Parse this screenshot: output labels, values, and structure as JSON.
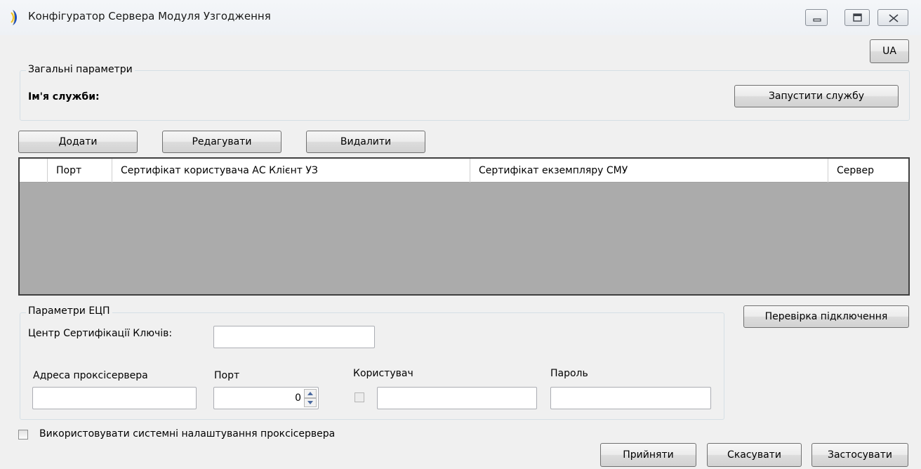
{
  "window": {
    "title": "Конфігуратор Сервера Модуля Узгодження",
    "language_button": "UA"
  },
  "general": {
    "legend": "Загальні параметри",
    "service_name_label": "Ім'я служби:",
    "service_name_value": "",
    "start_service_button": "Запустити службу"
  },
  "toolbar": {
    "add": "Додати",
    "edit": "Редагувати",
    "delete": "Видалити"
  },
  "table": {
    "columns": [
      "Порт",
      "Сертифікат користувача АС Клієнт УЗ",
      "Сертифікат екземпляру СМУ",
      "Сервер"
    ],
    "rows": []
  },
  "signature": {
    "legend": "Параметри ЕЦП",
    "ca_label": "Центр Сертифікації Ключів:",
    "ca_value": "",
    "proxy_address_label": "Адреса проксісервера",
    "proxy_address_value": "",
    "port_label": "Порт",
    "port_value": "0",
    "user_label": "Користувач",
    "user_checked": false,
    "user_value": "",
    "password_label": "Пароль",
    "password_value": ""
  },
  "check_connection_button": "Перевірка підключення",
  "use_system_proxy_label": "Використовувати системні налаштування проксісервера",
  "use_system_proxy_checked": false,
  "footer": {
    "accept": "Прийняти",
    "cancel": "Скасувати",
    "apply": "Застосувати"
  },
  "colors": {
    "grid_background": "#ababab",
    "window_background": "#f0f0f0"
  }
}
